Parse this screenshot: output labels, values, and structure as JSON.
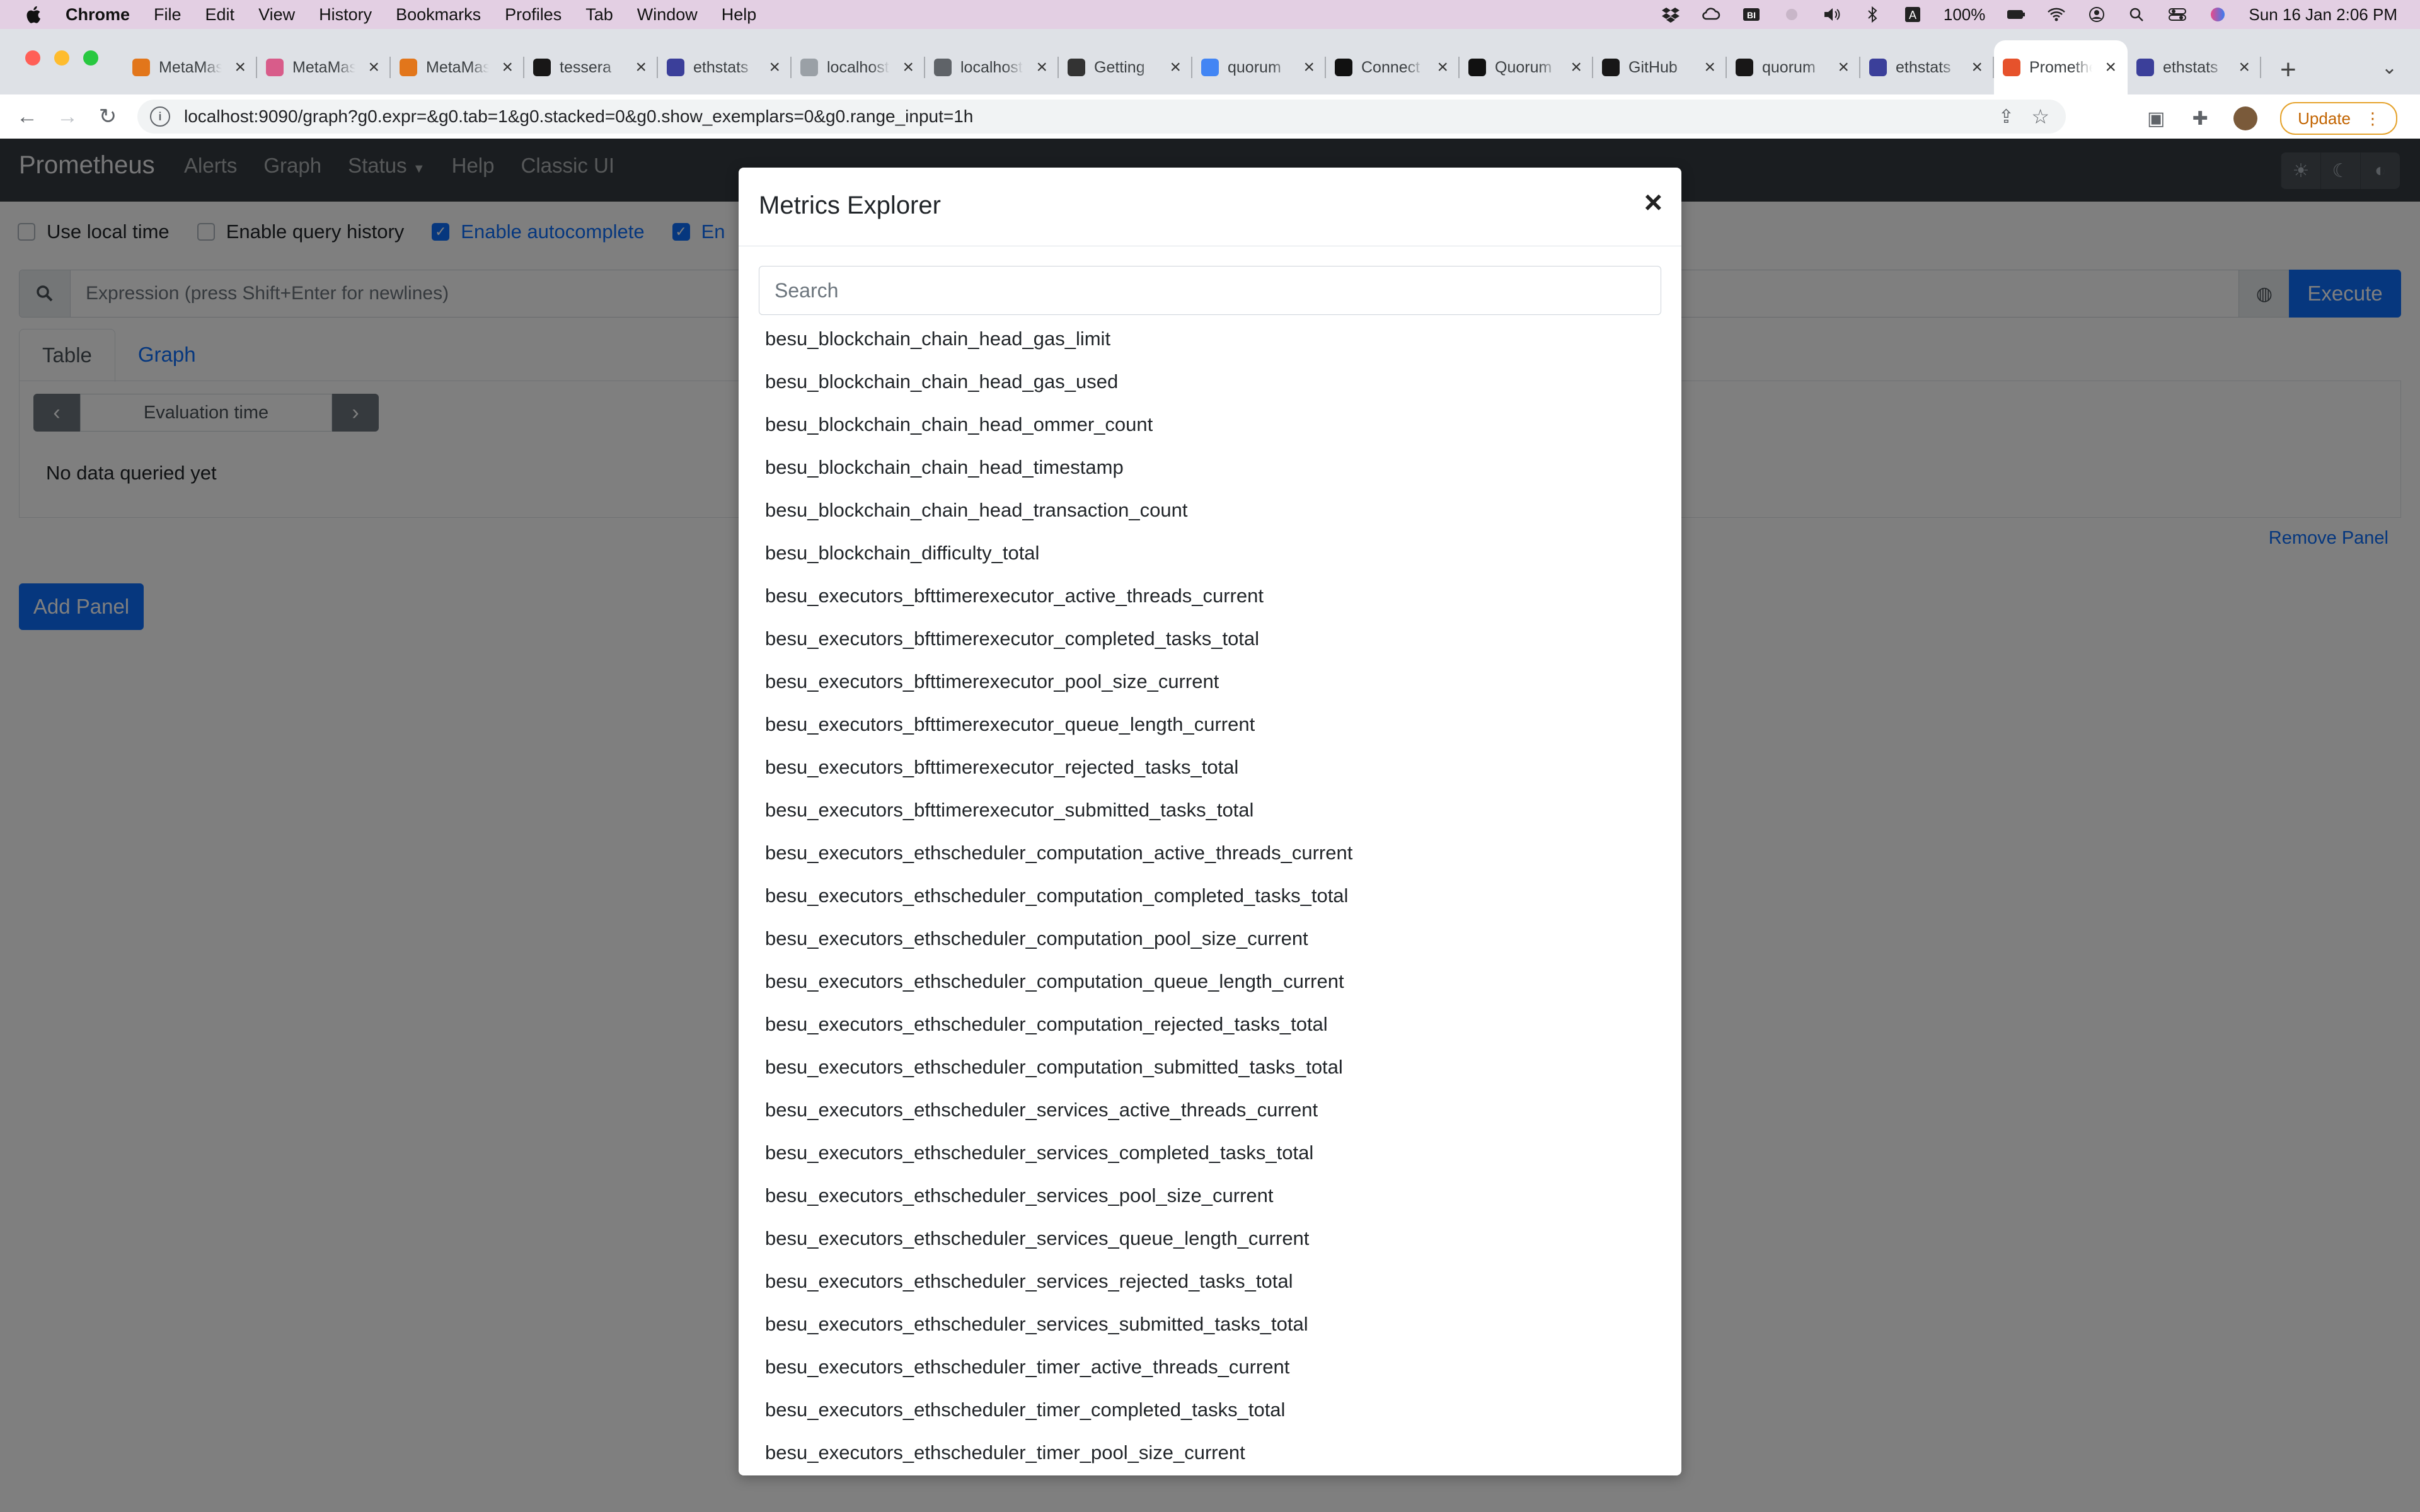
{
  "mac_menu": {
    "app": "Chrome",
    "items": [
      "File",
      "Edit",
      "View",
      "History",
      "Bookmarks",
      "Profiles",
      "Tab",
      "Window",
      "Help"
    ],
    "battery": "100%",
    "datetime": "Sun 16 Jan  2:06 PM"
  },
  "tabs": [
    {
      "title": "MetaMask",
      "icon": "metamask-fox-icon",
      "color": "#e2761b"
    },
    {
      "title": "MetaMask",
      "icon": "rainbow-icon",
      "color": "#d85c8a"
    },
    {
      "title": "MetaMask",
      "icon": "metamask-fox-icon",
      "color": "#e2761b"
    },
    {
      "title": "tessera",
      "icon": "github-icon",
      "color": "#181717"
    },
    {
      "title": "ethstats",
      "icon": "ethstats-icon",
      "color": "#3b3f9a"
    },
    {
      "title": "localhost",
      "icon": "grey-drop-icon",
      "color": "#9aa0a6"
    },
    {
      "title": "localhost",
      "icon": "globe-icon",
      "color": "#5f6368"
    },
    {
      "title": "Getting",
      "icon": "hardhat-icon",
      "color": "#333333"
    },
    {
      "title": "quorum",
      "icon": "google-icon",
      "color": "#4285f4"
    },
    {
      "title": "Connect",
      "icon": "consensys-icon",
      "color": "#111111"
    },
    {
      "title": "Quorum",
      "icon": "consensys-icon",
      "color": "#111111"
    },
    {
      "title": "GitHub",
      "icon": "github-icon",
      "color": "#181717"
    },
    {
      "title": "quorum",
      "icon": "github-icon",
      "color": "#181717"
    },
    {
      "title": "ethstats",
      "icon": "ethstats-icon",
      "color": "#3b3f9a"
    },
    {
      "title": "Prometheus",
      "icon": "prometheus-icon",
      "color": "#e6522c",
      "active": true
    },
    {
      "title": "ethstats",
      "icon": "ethstats-icon",
      "color": "#3b3f9a"
    }
  ],
  "toolbar": {
    "url": "localhost:9090/graph?g0.expr=&g0.tab=1&g0.stacked=0&g0.show_exemplars=0&g0.range_input=1h",
    "update_label": "Update"
  },
  "prometheus": {
    "brand": "Prometheus",
    "nav": [
      "Alerts",
      "Graph",
      "Status",
      "Help",
      "Classic UI"
    ],
    "options": [
      {
        "label": "Use local time",
        "checked": false
      },
      {
        "label": "Enable query history",
        "checked": false
      },
      {
        "label": "Enable autocomplete",
        "checked": true
      },
      {
        "label": "En",
        "checked": true
      }
    ],
    "expression_placeholder": "Expression (press Shift+Enter for newlines)",
    "execute_label": "Execute",
    "panel_tabs": [
      "Table",
      "Graph"
    ],
    "evaluation_time": "Evaluation time",
    "no_data": "No data queried yet",
    "remove_panel": "Remove Panel",
    "add_panel": "Add Panel"
  },
  "modal": {
    "title": "Metrics Explorer",
    "close": "×",
    "search_placeholder": "Search",
    "metrics": [
      "besu_blockchain_chain_head_gas_limit",
      "besu_blockchain_chain_head_gas_used",
      "besu_blockchain_chain_head_ommer_count",
      "besu_blockchain_chain_head_timestamp",
      "besu_blockchain_chain_head_transaction_count",
      "besu_blockchain_difficulty_total",
      "besu_executors_bfttimerexecutor_active_threads_current",
      "besu_executors_bfttimerexecutor_completed_tasks_total",
      "besu_executors_bfttimerexecutor_pool_size_current",
      "besu_executors_bfttimerexecutor_queue_length_current",
      "besu_executors_bfttimerexecutor_rejected_tasks_total",
      "besu_executors_bfttimerexecutor_submitted_tasks_total",
      "besu_executors_ethscheduler_computation_active_threads_current",
      "besu_executors_ethscheduler_computation_completed_tasks_total",
      "besu_executors_ethscheduler_computation_pool_size_current",
      "besu_executors_ethscheduler_computation_queue_length_current",
      "besu_executors_ethscheduler_computation_rejected_tasks_total",
      "besu_executors_ethscheduler_computation_submitted_tasks_total",
      "besu_executors_ethscheduler_services_active_threads_current",
      "besu_executors_ethscheduler_services_completed_tasks_total",
      "besu_executors_ethscheduler_services_pool_size_current",
      "besu_executors_ethscheduler_services_queue_length_current",
      "besu_executors_ethscheduler_services_rejected_tasks_total",
      "besu_executors_ethscheduler_services_submitted_tasks_total",
      "besu_executors_ethscheduler_timer_active_threads_current",
      "besu_executors_ethscheduler_timer_completed_tasks_total",
      "besu_executors_ethscheduler_timer_pool_size_current"
    ]
  }
}
